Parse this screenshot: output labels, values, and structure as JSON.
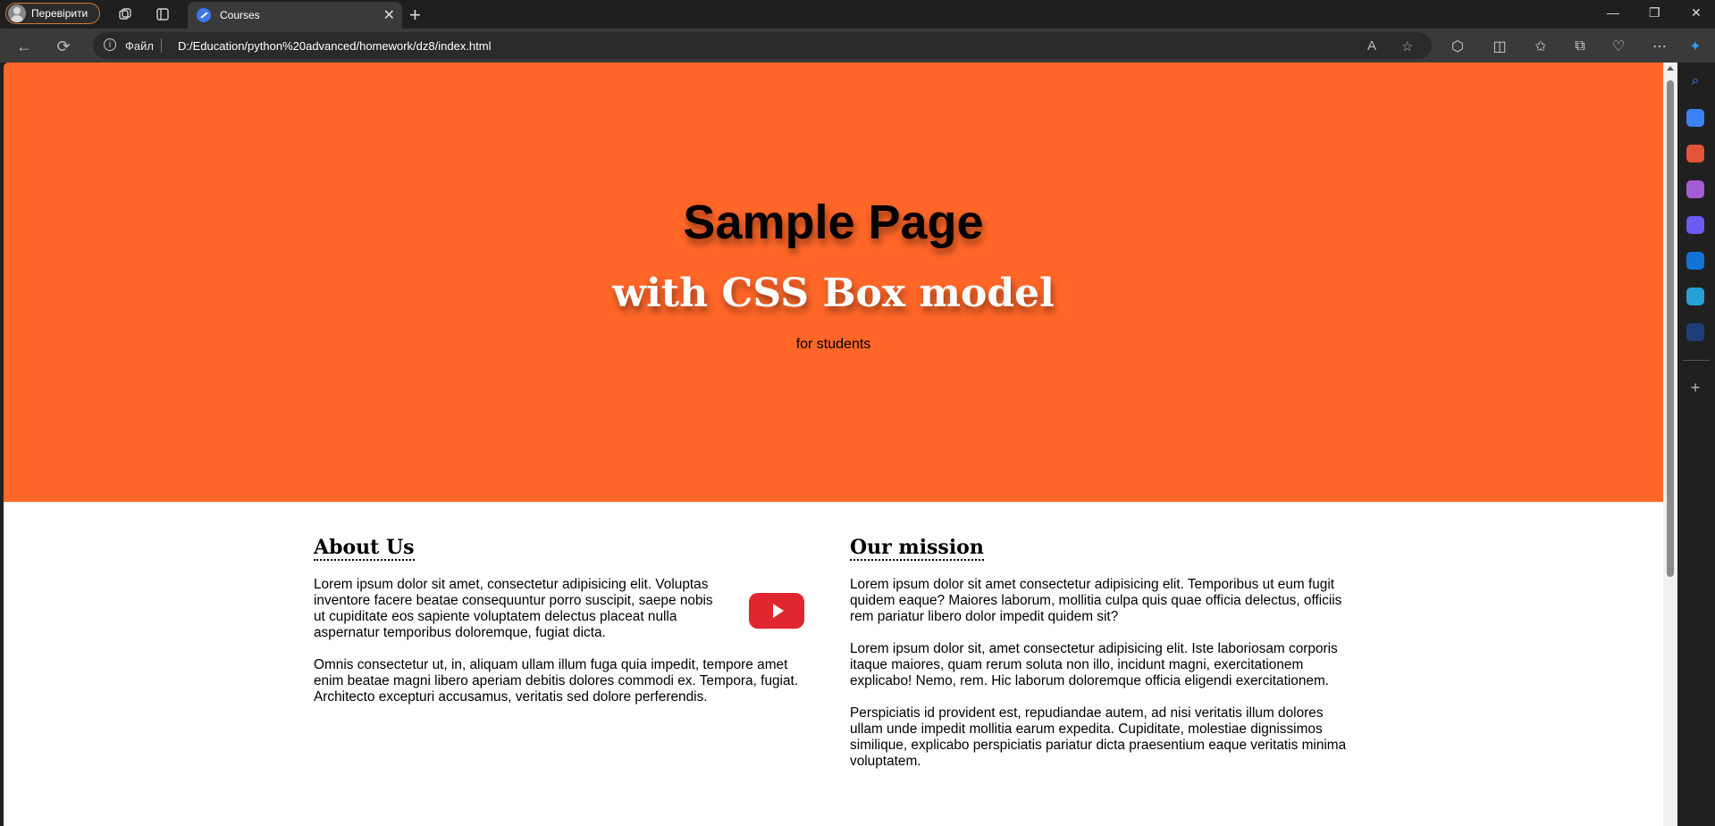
{
  "browser": {
    "profile_label": "Перевірити",
    "tab_title": "Courses",
    "scheme_label": "Файл",
    "url": "D:/Education/python%20advanced/homework/dz8/index.html"
  },
  "hero": {
    "title": "Sample Page",
    "subtitle": "with CSS Box model",
    "tagline": "for students",
    "background": "#ff6628"
  },
  "about": {
    "heading": "About Us",
    "paragraphs": [
      "Lorem ipsum dolor sit amet, consectetur adipisicing elit. Voluptas inventore facere beatae consequuntur porro suscipit, saepe nobis ut cupiditate eos sapiente voluptatem delectus placeat nulla aspernatur temporibus doloremque, fugiat dicta.",
      "Omnis consectetur ut, in, aliquam ullam illum fuga quia impedit, tempore amet enim beatae magni libero aperiam debitis dolores commodi ex. Tempora, fugiat. Architecto excepturi accusamus, veritatis sed dolore perferendis."
    ],
    "video_icon": "youtube-play-icon"
  },
  "mission": {
    "heading": "Our mission",
    "paragraphs": [
      "Lorem ipsum dolor sit amet consectetur adipisicing elit. Temporibus ut eum fugit quidem eaque? Maiores laborum, mollitia culpa quis quae officia delectus, officiis rem pariatur libero dolor impedit quidem sit?",
      "Lorem ipsum dolor sit, amet consectetur adipisicing elit. Iste laboriosam corporis itaque maiores, quam rerum soluta non illo, incidunt magni, exercitationem explicabo! Nemo, rem. Hic laborum doloremque officia eligendi exercitationem.",
      "Perspiciatis id provident est, repudiandae autem, ad nisi veritatis illum dolores ullam unde impedit mollitia earum expedita. Cupiditate, molestiae dignissimos similique, explicabo perspiciatis pariatur dicta praesentium eaque veritatis minima voluptatem."
    ]
  }
}
